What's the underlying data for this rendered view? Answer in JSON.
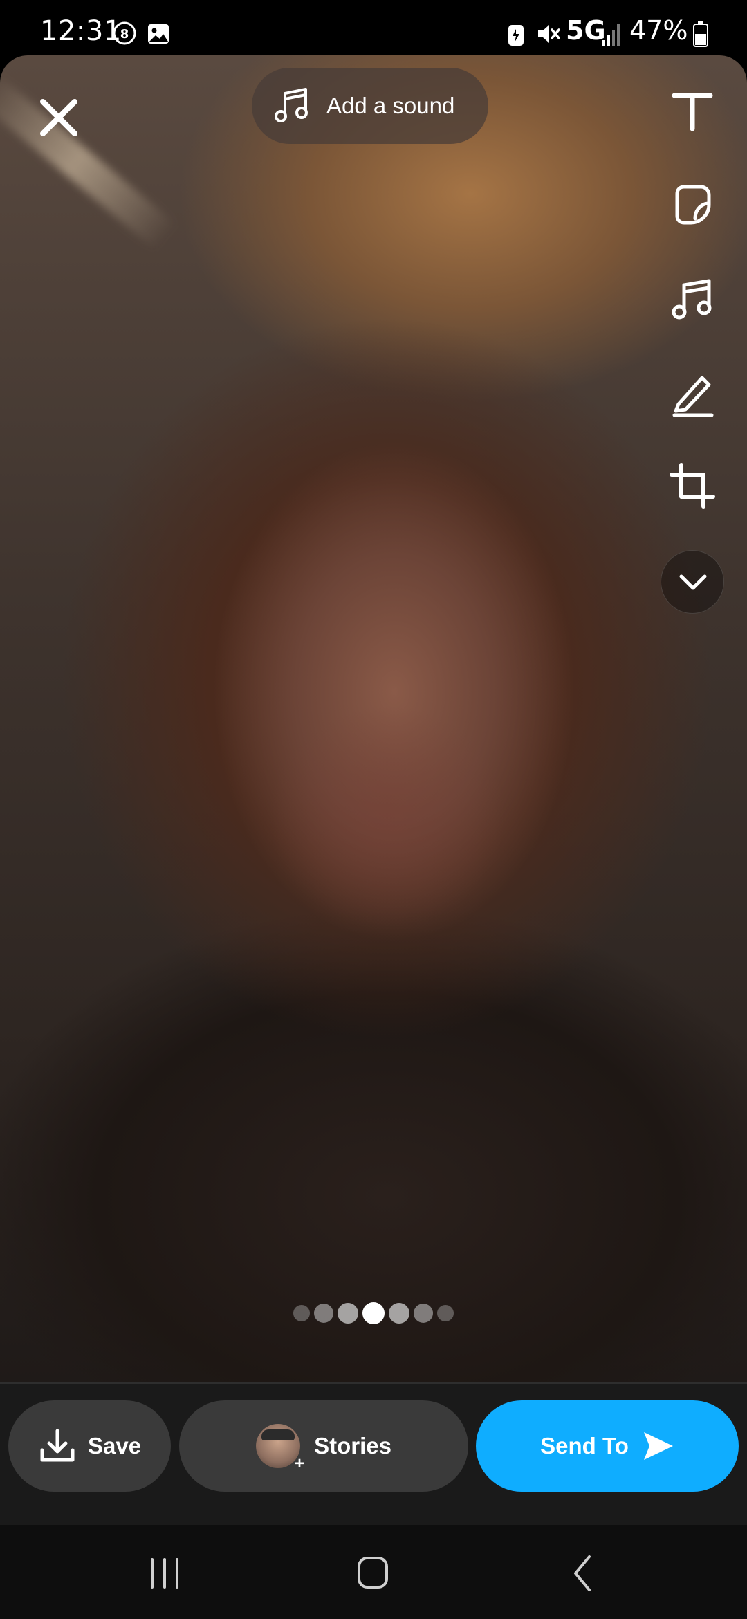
{
  "status_bar": {
    "time": "12:31",
    "network": "5G",
    "battery": "47%",
    "icons": [
      "notification-count-icon",
      "gallery-icon",
      "battery-saver-icon",
      "mute-icon",
      "signal-icon",
      "battery-icon"
    ]
  },
  "editor": {
    "close_icon": "close-icon",
    "sound_button": {
      "label": "Add a sound",
      "icon": "music-note-icon"
    },
    "tools": [
      "text-tool-icon",
      "sticker-icon",
      "music-note-icon",
      "pencil-icon",
      "crop-icon",
      "chevron-down-icon"
    ],
    "page_indicator": {
      "total": 7,
      "active": 4
    }
  },
  "actions": {
    "save_label": "Save",
    "stories_label": "Stories",
    "send_label": "Send To",
    "send_color": "#0fadff"
  },
  "navigation": [
    "recents-icon",
    "home-icon",
    "back-icon"
  ]
}
